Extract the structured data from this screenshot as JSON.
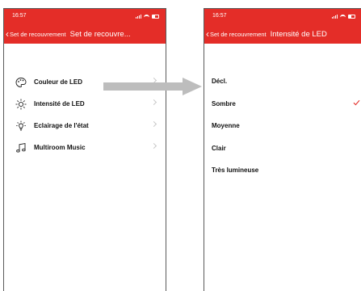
{
  "left": {
    "status_time": "16:57",
    "back_label": "Set de recouvrement",
    "title": "Set de recouvre...",
    "items": [
      {
        "label": "Couleur de LED",
        "icon": "palette-icon"
      },
      {
        "label": "Intensité de LED",
        "icon": "sun-icon"
      },
      {
        "label": "Eclairage de l'état",
        "icon": "lightbulb-icon"
      },
      {
        "label": "Multiroom Music",
        "icon": "music-note-icon"
      }
    ]
  },
  "right": {
    "status_time": "16:57",
    "back_label": "Set de recouvrement",
    "title": "Intensité de LED",
    "options": [
      "Décl.",
      "Sombre",
      "Moyenne",
      "Clair",
      "Très lumineuse"
    ],
    "selected_index": 1
  },
  "colors": {
    "brand_red": "#e42d28",
    "connector_arrow": "#bdbdbd",
    "checkmark": "#e42d28"
  },
  "icons": {
    "back": "chevron-left-icon",
    "row_chevron": "chevron-right-icon",
    "selection": "checkmark-icon",
    "status": [
      "signal-icon",
      "wifi-icon",
      "battery-icon"
    ]
  }
}
